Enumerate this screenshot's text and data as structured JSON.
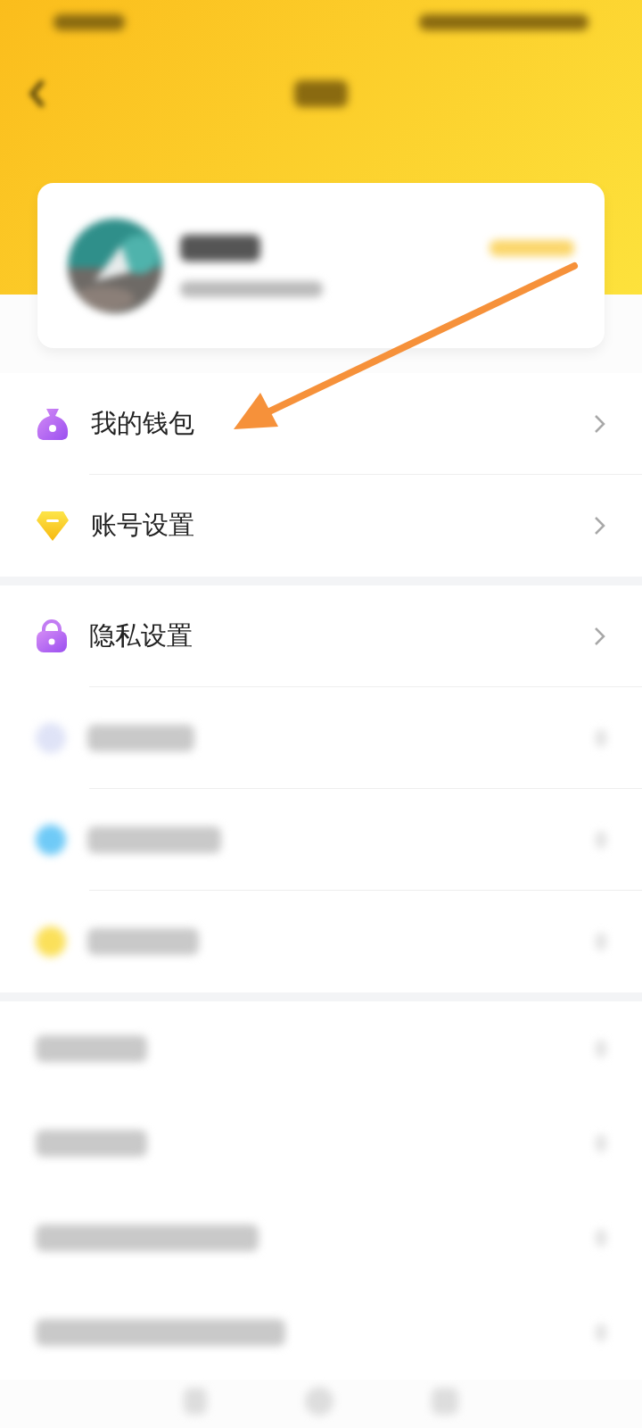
{
  "menu_group_1": [
    {
      "kind": "wallet",
      "label": "我的钱包"
    },
    {
      "kind": "diamond",
      "label": "账号设置"
    }
  ],
  "menu_group_2": [
    {
      "kind": "lock",
      "label": "隐私设置"
    },
    {
      "kind": "blurred",
      "color": "#dfe3f7"
    },
    {
      "kind": "blurred",
      "color": "#6fcaf7"
    },
    {
      "kind": "blurred",
      "color": "#fbe05a"
    }
  ],
  "menu_group_3": [
    {
      "kind": "blurred"
    },
    {
      "kind": "blurred"
    },
    {
      "kind": "blurred"
    },
    {
      "kind": "blurred"
    }
  ]
}
